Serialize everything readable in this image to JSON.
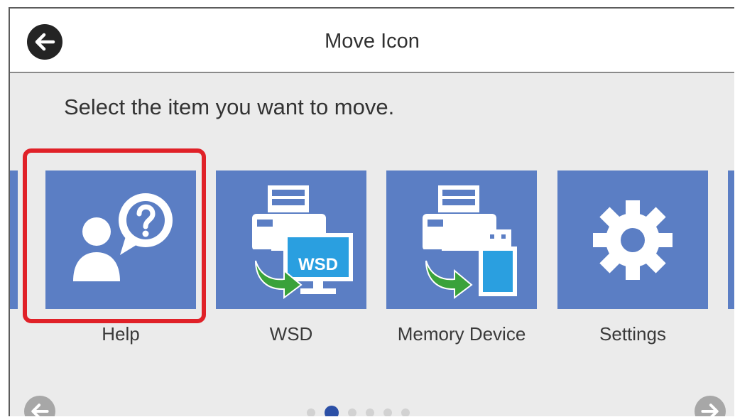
{
  "header": {
    "title": "Move Icon",
    "back_icon": "arrow-left-icon"
  },
  "instruction": "Select the item you want to move.",
  "tiles": [
    {
      "label": "Help",
      "icon": "help-person-icon",
      "selected": true
    },
    {
      "label": "WSD",
      "icon": "wsd-printer-computer-icon",
      "badge": "WSD",
      "selected": false
    },
    {
      "label": "Memory Device",
      "icon": "printer-memory-device-icon",
      "selected": false
    },
    {
      "label": "Settings",
      "icon": "gear-icon",
      "selected": false
    }
  ],
  "pagination": {
    "total_pages": 6,
    "current_page": 2,
    "prev_icon": "arrow-left-icon",
    "next_icon": "arrow-right-icon"
  },
  "colors": {
    "tile": "#5b7ec4",
    "highlight": "#e02128",
    "active_dot": "#2b4fa6",
    "green_arrow": "#3aa23a",
    "monitor": "#2a9fe0"
  }
}
